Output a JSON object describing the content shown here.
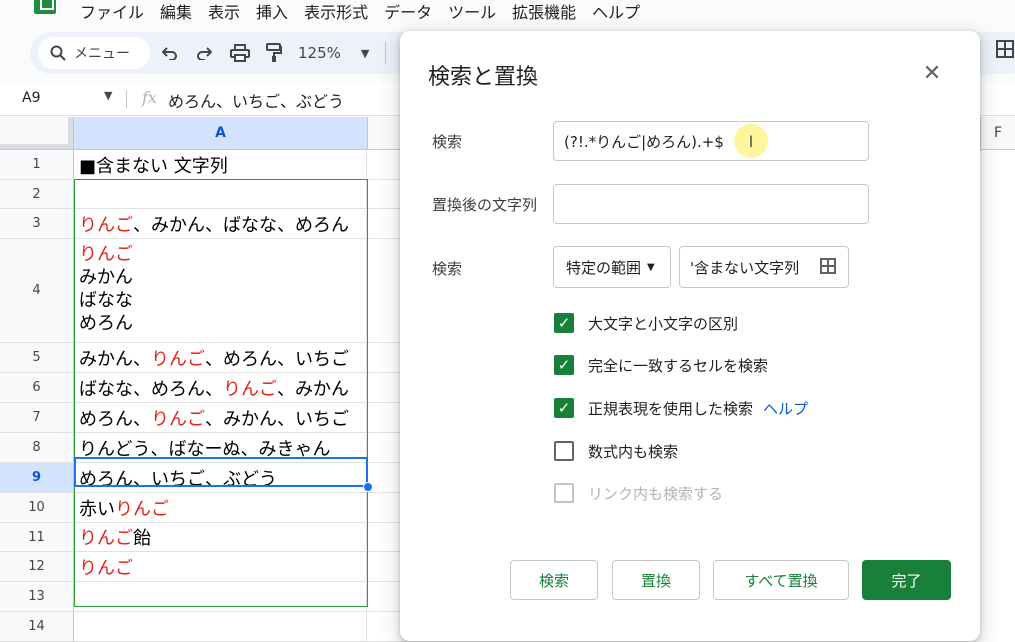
{
  "menu": {
    "items": [
      "ファイル",
      "編集",
      "表示",
      "挿入",
      "表示形式",
      "データ",
      "ツール",
      "拡張機能",
      "ヘルプ"
    ]
  },
  "toolbar": {
    "menu_search_label": "メニュー",
    "zoom": "125%"
  },
  "formula_bar": {
    "cell_ref": "A9",
    "fx_label": "fx",
    "content": "めろん、いちご、ぶどう"
  },
  "grid": {
    "col_a": "A",
    "col_f": "F",
    "rows": [
      {
        "num": "1",
        "segments": [
          {
            "text": "■含まない 文字列",
            "red": false
          }
        ]
      },
      {
        "num": "2",
        "segments": []
      },
      {
        "num": "3",
        "segments": [
          {
            "text": "りんご",
            "red": true
          },
          {
            "text": "、みかん、ばなな、めろん",
            "red": false
          }
        ]
      },
      {
        "num": "4",
        "lines": [
          {
            "text": "りんご",
            "red": true
          },
          {
            "text": "みかん",
            "red": false
          },
          {
            "text": "ばなな",
            "red": false
          },
          {
            "text": "めろん",
            "red": false
          }
        ]
      },
      {
        "num": "5",
        "segments": [
          {
            "text": "みかん、",
            "red": false
          },
          {
            "text": "りんご",
            "red": true
          },
          {
            "text": "、めろん、いちご",
            "red": false
          }
        ]
      },
      {
        "num": "6",
        "segments": [
          {
            "text": "ばなな、めろん、",
            "red": false
          },
          {
            "text": "りんご",
            "red": true
          },
          {
            "text": "、みかん",
            "red": false
          }
        ]
      },
      {
        "num": "7",
        "segments": [
          {
            "text": "めろん、",
            "red": false
          },
          {
            "text": "りんご",
            "red": true
          },
          {
            "text": "、みかん、いちご",
            "red": false
          }
        ]
      },
      {
        "num": "8",
        "segments": [
          {
            "text": "りんどう、ばなーぬ、みきゃん",
            "red": false
          }
        ]
      },
      {
        "num": "9",
        "segments": [
          {
            "text": "めろん、いちご、ぶどう",
            "red": false
          }
        ]
      },
      {
        "num": "10",
        "segments": [
          {
            "text": "赤い",
            "red": false
          },
          {
            "text": "りんご",
            "red": true
          }
        ]
      },
      {
        "num": "11",
        "segments": [
          {
            "text": "りんご",
            "red": true
          },
          {
            "text": "飴",
            "red": false
          }
        ]
      },
      {
        "num": "12",
        "segments": [
          {
            "text": "りんご",
            "red": true
          }
        ]
      },
      {
        "num": "13",
        "segments": []
      },
      {
        "num": "14",
        "segments": []
      }
    ]
  },
  "dialog": {
    "title": "検索と置換",
    "find_label": "検索",
    "find_value": "(?!.*りんご|めろん).+$",
    "replace_label": "置換後の文字列",
    "replace_value": "",
    "scope_label": "検索",
    "scope_value": "特定の範囲",
    "range_value": "'含まない文字列",
    "options": {
      "match_case": {
        "label": "大文字と小文字の区別",
        "checked": true
      },
      "match_entire": {
        "label": "完全に一致するセルを検索",
        "checked": true
      },
      "regex": {
        "label": "正規表現を使用した検索",
        "checked": true,
        "help": "ヘルプ"
      },
      "formulas": {
        "label": "数式内も検索",
        "checked": false
      },
      "links": {
        "label": "リンク内も検索する",
        "checked": false,
        "disabled": true
      }
    },
    "buttons": {
      "find": "検索",
      "replace": "置換",
      "replace_all": "すべて置換",
      "done": "完了"
    }
  },
  "colors": {
    "accent_green": "#188038",
    "selection_blue": "#1a73e8",
    "highlight_red": "#e0241a"
  }
}
